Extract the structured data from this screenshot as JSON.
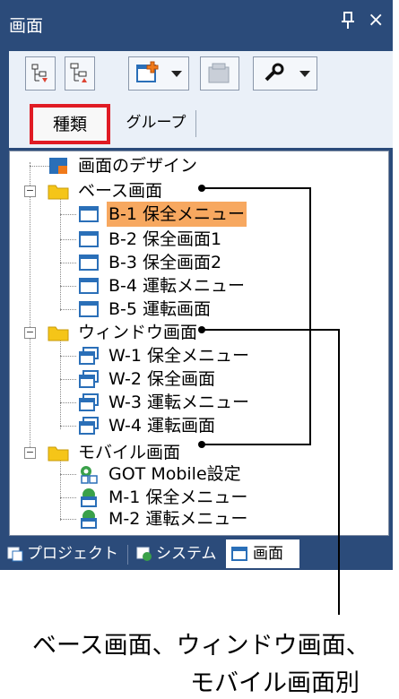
{
  "panel": {
    "title": "画面",
    "pin_glyph": "ᵗ",
    "close_glyph": "×"
  },
  "toolbar": {
    "buttons": [
      {
        "name": "sort-up-icon"
      },
      {
        "name": "sort-down-icon"
      },
      {
        "name": "new-screen-icon"
      },
      {
        "name": "disabled-screen-icon"
      },
      {
        "name": "wrench-icon"
      }
    ]
  },
  "tabs": {
    "kind": "種類",
    "group": "グループ"
  },
  "tree": {
    "items": [
      {
        "label": "画面のデザイン",
        "icon": "screen-design-icon"
      },
      {
        "label": "ベース画面",
        "icon": "folder-icon",
        "expander": "−"
      },
      {
        "label": "B-1 保全メニュー",
        "icon": "window-icon",
        "selected": true
      },
      {
        "label": "B-2 保全画面1",
        "icon": "window-icon"
      },
      {
        "label": "B-3 保全画面2",
        "icon": "window-icon"
      },
      {
        "label": "B-4 運転メニュー",
        "icon": "window-icon"
      },
      {
        "label": "B-5 運転画面",
        "icon": "window-icon"
      },
      {
        "label": "ウィンドウ画面",
        "icon": "folder-icon",
        "expander": "−"
      },
      {
        "label": "W-1 保全メニュー",
        "icon": "stacked-window-icon"
      },
      {
        "label": "W-2 保全画面",
        "icon": "stacked-window-icon"
      },
      {
        "label": "W-3 運転メニュー",
        "icon": "stacked-window-icon"
      },
      {
        "label": "W-4 運転画面",
        "icon": "stacked-window-icon"
      },
      {
        "label": "モバイル画面",
        "icon": "folder-icon",
        "expander": "−"
      },
      {
        "label": "GOT Mobile設定",
        "icon": "mobile-settings-icon"
      },
      {
        "label": "M-1 保全メニュー",
        "icon": "mobile-screen-icon"
      },
      {
        "label": "M-2 運転メニュー",
        "icon": "mobile-screen-icon"
      }
    ]
  },
  "bottom_tabs": [
    {
      "label": "プロジェクト",
      "icon": "project-icon"
    },
    {
      "label": "システム",
      "icon": "system-icon"
    },
    {
      "label": "画面",
      "icon": "screen-icon",
      "active": true
    }
  ],
  "caption": {
    "line1": "ベース画面、ウィンドウ画面、",
    "line2": "モバイル画面別"
  },
  "colors": {
    "panel_bg": "#2b4b7a",
    "highlight_red": "#e01b24",
    "selection_orange": "#f7a860",
    "folder_yellow": "#f5c518",
    "window_blue": "#2a6fb8"
  }
}
